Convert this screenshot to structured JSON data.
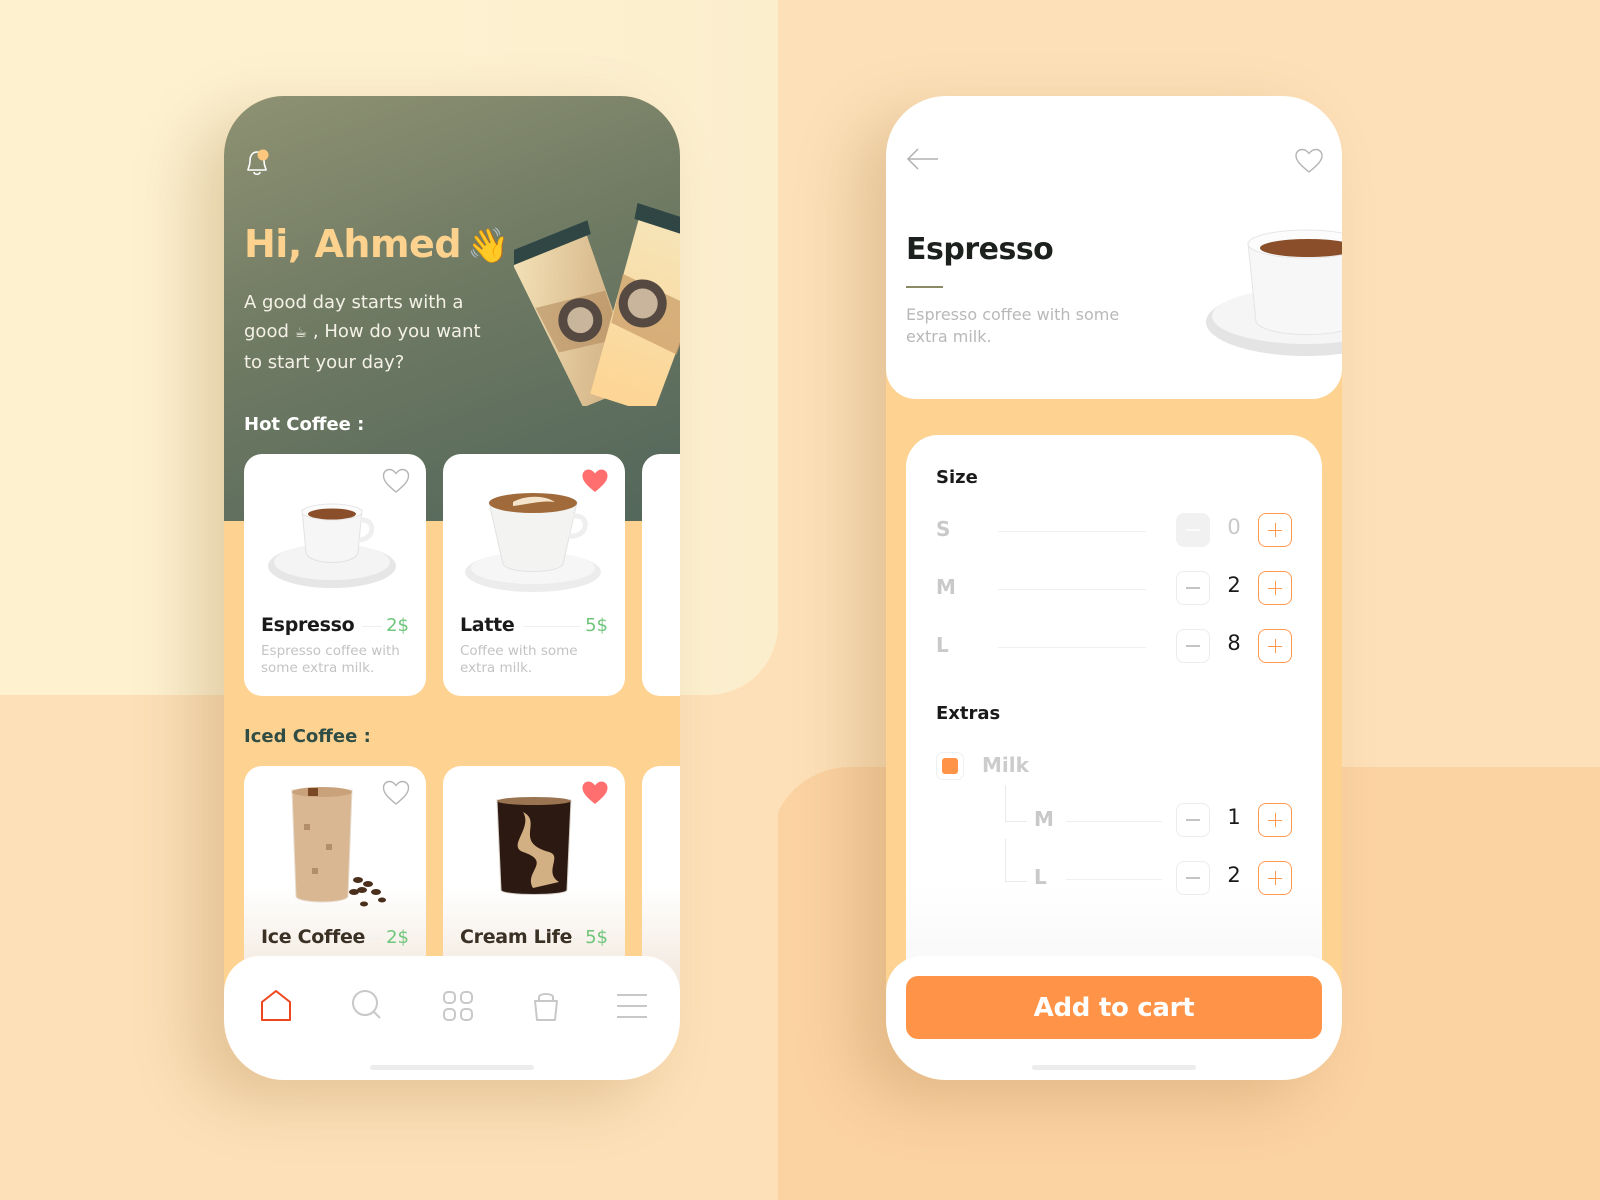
{
  "colors": {
    "accent_orange": "#ff9449",
    "price_green": "#6fc57a",
    "heart_red": "#ff6f6f",
    "hero_green": "#52665a",
    "greeting_yellow": "#fdd28f",
    "tab_active": "#f0461e"
  },
  "home": {
    "greeting": "Hi, Ahmed",
    "greeting_emoji": "👋",
    "tagline_part1": "A good day starts with a good",
    "tagline_emoji": "☕",
    "tagline_part2": ", How do you want to start your day?",
    "notification_icon": "bell-icon",
    "notification_badge": true,
    "sections": [
      {
        "title": "Hot Coffee :",
        "items": [
          {
            "name": "Espresso",
            "price": "2$",
            "description": "Espresso coffee with some extra milk.",
            "favorite": false,
            "image": "espresso-cup"
          },
          {
            "name": "Latte",
            "price": "5$",
            "description": "Coffee with some extra milk.",
            "favorite": true,
            "image": "latte-cup"
          }
        ]
      },
      {
        "title": "Iced Coffee :",
        "items": [
          {
            "name": "Ice Coffee",
            "price": "2$",
            "favorite": false,
            "image": "iced-coffee-glass"
          },
          {
            "name": "Cream Life",
            "price": "5$",
            "favorite": true,
            "image": "cream-coffee-glass"
          }
        ]
      }
    ],
    "tabbar": [
      {
        "name": "home",
        "icon": "home-icon",
        "active": true
      },
      {
        "name": "search",
        "icon": "search-icon",
        "active": false
      },
      {
        "name": "categories",
        "icon": "grid-icon",
        "active": false
      },
      {
        "name": "cart",
        "icon": "bag-icon",
        "active": false
      },
      {
        "name": "menu",
        "icon": "menu-icon",
        "active": false
      }
    ]
  },
  "detail": {
    "title": "Espresso",
    "description": "Espresso coffee with some extra milk.",
    "favorite": false,
    "size_heading": "Size",
    "sizes": [
      {
        "label": "S",
        "qty": "0"
      },
      {
        "label": "M",
        "qty": "2"
      },
      {
        "label": "L",
        "qty": "8"
      }
    ],
    "extras_heading": "Extras",
    "extras": [
      {
        "label": "Milk",
        "checked": true,
        "sizes": [
          {
            "label": "M",
            "qty": "1"
          },
          {
            "label": "L",
            "qty": "2"
          }
        ]
      }
    ],
    "add_to_cart_label": "Add to cart"
  }
}
